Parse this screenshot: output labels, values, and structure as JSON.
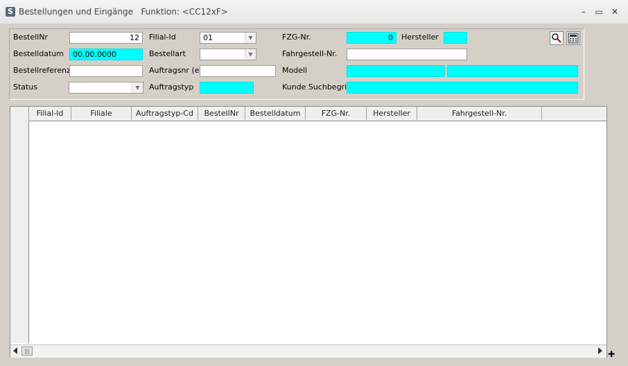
{
  "window": {
    "app_icon": "S",
    "title": "Bestellungen und Eingänge   Funktion: <CC12xF>",
    "min": "–",
    "max": "▭",
    "close": "✕"
  },
  "filters": {
    "bestellnr": {
      "label": "BestellNr",
      "value": "12"
    },
    "bestelldatum": {
      "label": "Bestelldatum",
      "value": "00.00.0000"
    },
    "bestellreferenz": {
      "label": "Bestellreferenz",
      "value": ""
    },
    "status": {
      "label": "Status",
      "value": ""
    },
    "filial_id": {
      "label": "Filial-Id",
      "value": "01"
    },
    "bestellart": {
      "label": "Bestellart",
      "value": ""
    },
    "auftragsnr_ext": {
      "label": "Auftragsnr (ext)",
      "value": ""
    },
    "auftragstyp": {
      "label": "Auftragstyp",
      "value": ""
    },
    "fzg_nr": {
      "label": "FZG-Nr.",
      "value": "0"
    },
    "hersteller": {
      "label": "Hersteller",
      "value": ""
    },
    "fahrgestell_nr": {
      "label": "Fahrgestell-Nr.",
      "value": ""
    },
    "modell": {
      "label": "Modell",
      "value": "",
      "value2": ""
    },
    "kunde_suchbegriff": {
      "label": "Kunde Suchbegriff",
      "value": ""
    }
  },
  "toolbar": {
    "search_icon": "search-icon",
    "calculator_icon": "calculator-icon"
  },
  "grid": {
    "columns": [
      "Filial-Id",
      "Filiale",
      "Auftragstyp-Cd",
      "BestellNr",
      "Bestelldatum",
      "FZG-Nr.",
      "Hersteller",
      "Fahrgestell-Nr."
    ],
    "rows": []
  },
  "colors": {
    "required_field": "#00ffff",
    "window_bg": "#d4d0c8"
  }
}
